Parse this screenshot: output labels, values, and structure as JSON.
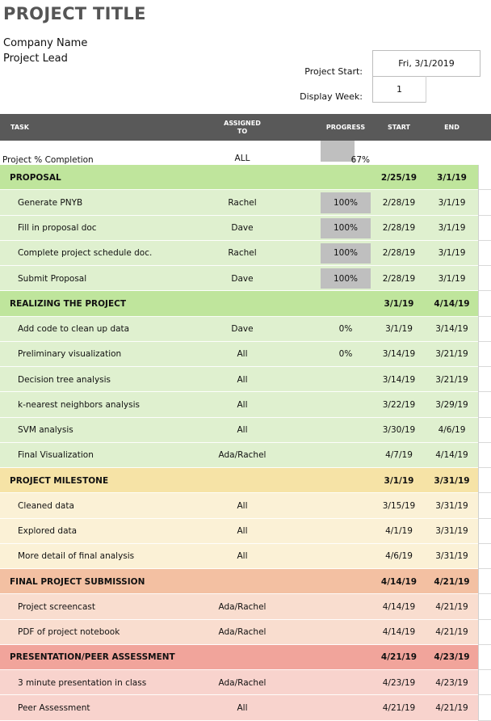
{
  "header": {
    "title": "PROJECT TITLE",
    "company": "Company Name",
    "lead": "Project Lead",
    "project_start_label": "Project Start:",
    "project_start_value": "Fri, 3/1/2019",
    "display_week_label": "Display Week:",
    "display_week_value": "1"
  },
  "columns": {
    "task": "TASK",
    "assigned": "ASSIGNED\nTO",
    "progress": "PROGRESS",
    "start": "START",
    "end": "END"
  },
  "completion": {
    "label": "Project % Completion",
    "assigned": "ALL",
    "progress_text": "67%",
    "progress_value": 0.67
  },
  "colors": {
    "header_bg": "#595959",
    "green_section": "#bfe59c",
    "green_row": "#dff0cf",
    "yellow_section": "#f6e3a6",
    "yellow_row": "#fbf1d6",
    "orange_section": "#f3c0a2",
    "orange_row": "#f9ddcf",
    "red_section": "#f1a49b",
    "red_row": "#f8d3cd",
    "progress_fill": "#bfbfbf"
  },
  "rows": [
    {
      "type": "section",
      "color": "green",
      "task": "PROPOSAL",
      "assigned": "",
      "progress": "",
      "start": "2/25/19",
      "end": "3/1/19"
    },
    {
      "type": "task",
      "color": "green",
      "task": "Generate PNYB",
      "assigned": "Rachel",
      "progress": "100%",
      "progress_value": 1,
      "start": "2/28/19",
      "end": "3/1/19"
    },
    {
      "type": "task",
      "color": "green",
      "task": "Fill in proposal doc",
      "assigned": "Dave",
      "progress": "100%",
      "progress_value": 1,
      "start": "2/28/19",
      "end": "3/1/19"
    },
    {
      "type": "task",
      "color": "green",
      "task": "Complete project schedule doc.",
      "assigned": "Rachel",
      "progress": "100%",
      "progress_value": 1,
      "start": "2/28/19",
      "end": "3/1/19"
    },
    {
      "type": "task",
      "color": "green",
      "task": "Submit Proposal",
      "assigned": "Dave",
      "progress": "100%",
      "progress_value": 1,
      "start": "2/28/19",
      "end": "3/1/19"
    },
    {
      "type": "section",
      "color": "green",
      "task": "REALIZING THE PROJECT",
      "assigned": "",
      "progress": "",
      "start": "3/1/19",
      "end": "4/14/19"
    },
    {
      "type": "task",
      "color": "green",
      "task": "Add code to clean up data",
      "assigned": "Dave",
      "progress": "0%",
      "progress_value": 0,
      "start": "3/1/19",
      "end": "3/14/19"
    },
    {
      "type": "task",
      "color": "green",
      "task": "Preliminary visualization",
      "assigned": "All",
      "progress": "0%",
      "progress_value": 0,
      "start": "3/14/19",
      "end": "3/21/19"
    },
    {
      "type": "task",
      "color": "green",
      "task": "Decision tree analysis",
      "assigned": "All",
      "progress": "",
      "start": "3/14/19",
      "end": "3/21/19"
    },
    {
      "type": "task",
      "color": "green",
      "task": "k-nearest neighbors analysis",
      "assigned": "All",
      "progress": "",
      "start": "3/22/19",
      "end": "3/29/19"
    },
    {
      "type": "task",
      "color": "green",
      "task": "SVM analysis",
      "assigned": "All",
      "progress": "",
      "start": "3/30/19",
      "end": "4/6/19"
    },
    {
      "type": "task",
      "color": "green",
      "task": "Final Visualization",
      "assigned": "Ada/Rachel",
      "progress": "",
      "start": "4/7/19",
      "end": "4/14/19"
    },
    {
      "type": "section",
      "color": "yellow",
      "task": "PROJECT MILESTONE",
      "assigned": "",
      "progress": "",
      "start": "3/1/19",
      "end": "3/31/19"
    },
    {
      "type": "task",
      "color": "yellow",
      "task": "Cleaned data",
      "assigned": "All",
      "progress": "",
      "start": "3/15/19",
      "end": "3/31/19"
    },
    {
      "type": "task",
      "color": "yellow",
      "task": "Explored data",
      "assigned": "All",
      "progress": "",
      "start": "4/1/19",
      "end": "3/31/19"
    },
    {
      "type": "task",
      "color": "yellow",
      "task": "More detail of final analysis",
      "assigned": "All",
      "progress": "",
      "start": "4/6/19",
      "end": "3/31/19"
    },
    {
      "type": "section",
      "color": "orange",
      "task": "FINAL PROJECT SUBMISSION",
      "assigned": "",
      "progress": "",
      "start": "4/14/19",
      "end": "4/21/19"
    },
    {
      "type": "task",
      "color": "orange",
      "task": "Project screencast",
      "assigned": "Ada/Rachel",
      "progress": "",
      "start": "4/14/19",
      "end": "4/21/19"
    },
    {
      "type": "task",
      "color": "orange",
      "task": "PDF of project notebook",
      "assigned": "Ada/Rachel",
      "progress": "",
      "start": "4/14/19",
      "end": "4/21/19"
    },
    {
      "type": "section",
      "color": "red",
      "task": "PRESENTATION/PEER ASSESSMENT",
      "assigned": "",
      "progress": "",
      "start": "4/21/19",
      "end": "4/23/19"
    },
    {
      "type": "task",
      "color": "red",
      "task": "3 minute presentation in class",
      "assigned": "Ada/Rachel",
      "progress": "",
      "start": "4/23/19",
      "end": "4/23/19"
    },
    {
      "type": "task",
      "color": "red",
      "task": "Peer Assessment",
      "assigned": "All",
      "progress": "",
      "start": "4/21/19",
      "end": "4/21/19"
    }
  ]
}
